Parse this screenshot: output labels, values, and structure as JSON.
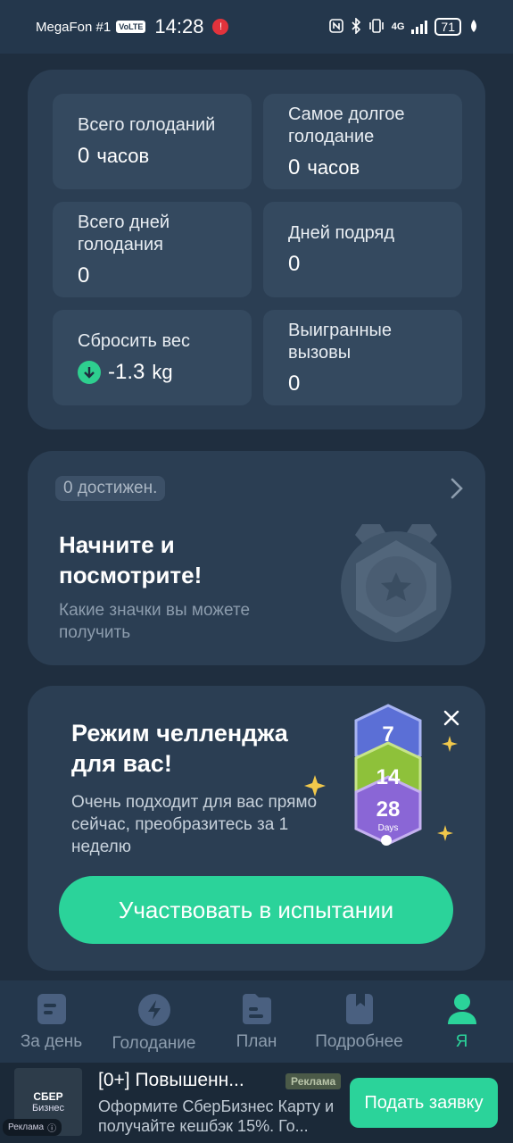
{
  "status_bar": {
    "carrier": "MegaFon #1",
    "volte": "VoLTE",
    "time": "14:28",
    "network": "4G",
    "battery": "71"
  },
  "stats": [
    {
      "label": "Всего голоданий",
      "value": "0",
      "unit": "часов"
    },
    {
      "label": "Самое долгое голодание",
      "value": "0",
      "unit": "часов"
    },
    {
      "label": "Всего дней голодания",
      "value": "0",
      "unit": ""
    },
    {
      "label": "Дней подряд",
      "value": "0",
      "unit": ""
    },
    {
      "label": "Сбросить вес",
      "value": "-1.3",
      "unit": "kg",
      "icon": "arrow-down-circle-icon"
    },
    {
      "label": "Выигранные вызовы",
      "value": "0",
      "unit": ""
    }
  ],
  "achievements": {
    "count_label": "0 достижен.",
    "title": "Начните и посмотрите!",
    "subtitle": "Какие значки вы можете получить"
  },
  "challenge": {
    "title": "Режим челленджа для вас!",
    "subtitle": "Очень подходит для вас прямо сейчас, преобразитесь за 1 неделю",
    "badge_days": [
      "7",
      "14",
      "28"
    ],
    "badge_unit": "Days",
    "button": "Участвовать в испытании"
  },
  "tabs": [
    {
      "label": "За день",
      "icon": "daily-icon",
      "active": false
    },
    {
      "label": "Голодание",
      "icon": "lightning-icon",
      "active": false
    },
    {
      "label": "План",
      "icon": "plan-icon",
      "active": false
    },
    {
      "label": "Подробнее",
      "icon": "bookmark-icon",
      "active": false
    },
    {
      "label": "Я",
      "icon": "profile-icon",
      "active": true
    }
  ],
  "ad": {
    "logo_line1": "СБЕР",
    "logo_line2": "Бизнес",
    "ad_tag": "Реклама",
    "title": "[0+] Повышенн...",
    "badge": "Реклама",
    "text": "Оформите СберБизнес Карту и получайте кешбэк 15%. Го...",
    "cta": "Подать заявку"
  },
  "colors": {
    "accent": "#2bd39a",
    "background": "#1f2e3f",
    "card": "#2b3e53"
  }
}
